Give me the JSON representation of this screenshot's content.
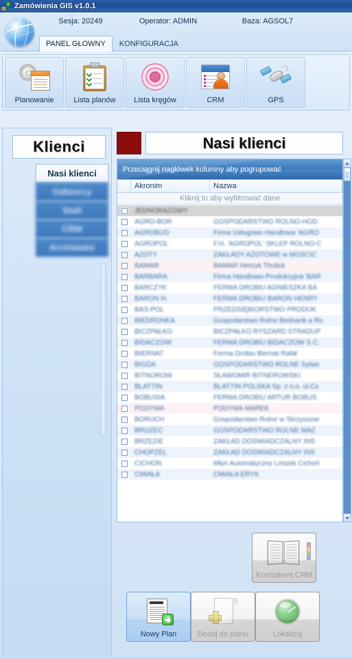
{
  "window": {
    "title": "Zamówienia GIS v1.0.1",
    "app_icon": "app-icon"
  },
  "header": {
    "session_label": "Sesja: 20249",
    "operator_label": "Operator: ADMIN",
    "database_label": "Baza: AGSOL7",
    "globe_icon": "globe-icon",
    "tabs": [
      {
        "label": "PANEL GŁOWNY",
        "active": true
      },
      {
        "label": "KONFIGURACJA",
        "active": false
      }
    ]
  },
  "ribbon": {
    "buttons": [
      {
        "label": "Planowanie",
        "icon": "planning-icon"
      },
      {
        "label": "Lista planów",
        "icon": "clipboard-icon"
      },
      {
        "label": "Lista kręgów",
        "icon": "target-icon"
      },
      {
        "label": "CRM",
        "icon": "contact-card-icon"
      },
      {
        "label": "GPS",
        "icon": "satellite-icon"
      }
    ]
  },
  "sidebar": {
    "title": "Klienci",
    "items": [
      {
        "label": "Nasi klienci",
        "active": true,
        "blurred": false
      },
      {
        "label": "Odbiorcy",
        "active": false,
        "blurred": true
      },
      {
        "label": "Stali",
        "active": false,
        "blurred": true
      },
      {
        "label": "CRM",
        "active": false,
        "blurred": true
      },
      {
        "label": "Archiwalni",
        "active": false,
        "blurred": true
      }
    ]
  },
  "main": {
    "page_title": "Nasi klienci",
    "accent_color": "#8c0b0b",
    "grid": {
      "group_hint": "Przeciągnij nagłówek kolumny aby pogrupować",
      "filter_hint": "Kliknij tu aby wyfiltrować dane",
      "columns": [
        "Akronim",
        "Nazwa"
      ],
      "rows": [
        {
          "akronim": "JEDNORAZOWY",
          "nazwa": ""
        },
        {
          "akronim": "AGRO-BOR",
          "nazwa": "GOSPODARSTWO ROLNO-HOD"
        },
        {
          "akronim": "AGROBUD",
          "nazwa": "Firma Usługowo Handlowa 'AGRO"
        },
        {
          "akronim": "AGROPOL",
          "nazwa": "F.H. 'AGROPOL' SKLEP ROLNO-C"
        },
        {
          "akronim": "AZOTY",
          "nazwa": "ZAKŁADY AZOTOWE w MOŚCIC"
        },
        {
          "akronim": "BAMAR",
          "nazwa": "BAMAR Henryk Thulick"
        },
        {
          "akronim": "BARBARA",
          "nazwa": "Firma Handlowo-Produkcyjna 'BAR"
        },
        {
          "akronim": "BARCZYK",
          "nazwa": "FERMA DROBIU AGNIESZKA BA"
        },
        {
          "akronim": "BARON H.",
          "nazwa": "FERMA DROBIU BARON HENRY"
        },
        {
          "akronim": "BAS-POL",
          "nazwa": "PRZEDSIĘBIORSTWO PRODUK"
        },
        {
          "akronim": "BIEDRONKA",
          "nazwa": "Gospodarstwo Rolne Bednarik a Ro"
        },
        {
          "akronim": "BICZPAŁKO",
          "nazwa": "BICZPAŁKO RYSZARD STRADUP"
        },
        {
          "akronim": "BIDACZÓW",
          "nazwa": "FERMA DROBIU BIDACZÓW S.C."
        },
        {
          "akronim": "BIERNAT",
          "nazwa": "Ferma Drobiu Biernat Rafał"
        },
        {
          "akronim": "BIGDA",
          "nazwa": "GOSPODARSTWO ROLNE Sylwe"
        },
        {
          "akronim": "BITNOROW",
          "nazwa": "SŁAWOMIR BITNEROWSKI"
        },
        {
          "akronim": "BLATTIN",
          "nazwa": "BLATTIN POLSKA Sp. z o.o. ul.Cx"
        },
        {
          "akronim": "BOBUSIA",
          "nazwa": "FERMA DROBIU ARTUR BOBUS"
        },
        {
          "akronim": "PODYMA",
          "nazwa": "PODYMA MAREK"
        },
        {
          "akronim": "BORUCH",
          "nazwa": "Gospodarstwo Rolne w Skrzyszow"
        },
        {
          "akronim": "BROŻEC",
          "nazwa": "GOSPODARSTWO ROLNE MAZ"
        },
        {
          "akronim": "BRZEZIE",
          "nazwa": "ZAKŁAD DOŚWIADCZALNY INS"
        },
        {
          "akronim": "CHOPZEL",
          "nazwa": "ZAKŁAD DOŚWIADCZALNY INS"
        },
        {
          "akronim": "CICHOŃ",
          "nazwa": "Młyn Automatyczny Leszek Cichoń"
        },
        {
          "akronim": "CMIAŁA",
          "nazwa": "CMIAŁA ERYK"
        }
      ]
    },
    "actions": [
      {
        "label": "Kontrahent CRM",
        "icon": "address-book-icon",
        "state": "disabled"
      },
      {
        "label": "Nowy Plan",
        "icon": "new-document-icon",
        "state": "primary"
      },
      {
        "label": "Dodaj do planu",
        "icon": "add-page-icon",
        "state": "disabled"
      },
      {
        "label": "Lokalizuj",
        "icon": "radar-icon",
        "state": "disabled"
      }
    ]
  }
}
